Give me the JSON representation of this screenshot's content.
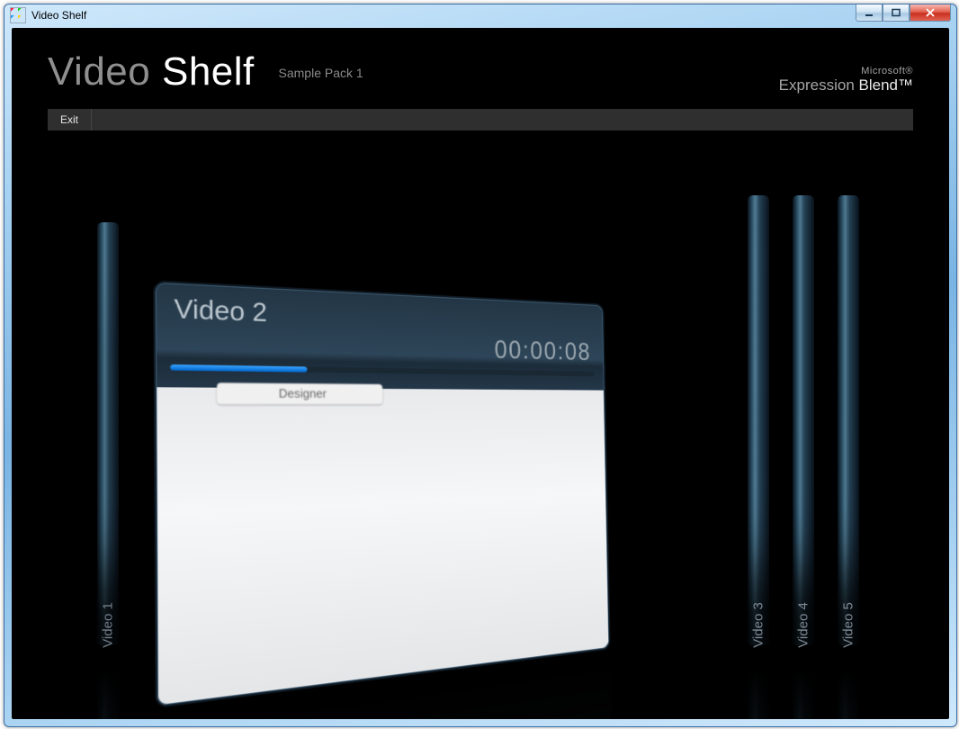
{
  "window": {
    "title": "Video Shelf"
  },
  "header": {
    "appname_first": "Video",
    "appname_second": "Shelf",
    "subtitle": "Sample Pack 1"
  },
  "logo": {
    "line1": "Microsoft®",
    "line2a": "Expression",
    "line2b": "Blend™"
  },
  "menubar": {
    "exit_label": "Exit"
  },
  "shelf": {
    "spines": [
      {
        "label": "Video 1"
      },
      {
        "label": "Video 3"
      },
      {
        "label": "Video 4"
      },
      {
        "label": "Video 5"
      }
    ],
    "open_card": {
      "title": "Video 2",
      "time": "00:00:08",
      "progress_percent": 28,
      "chip_text": "Designer"
    }
  }
}
